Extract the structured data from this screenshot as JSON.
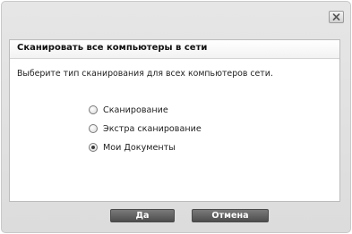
{
  "dialog": {
    "close_icon": "close-icon",
    "heading": "Сканировать все компьютеры в сети",
    "description": "Выберите тип сканирования для всех компьютеров сети.",
    "options": [
      {
        "label": "Сканирование",
        "selected": false
      },
      {
        "label": "Экстра сканирование",
        "selected": false
      },
      {
        "label": "Мои Документы",
        "selected": true
      }
    ],
    "ok_label": "Да",
    "cancel_label": "Отмена"
  }
}
